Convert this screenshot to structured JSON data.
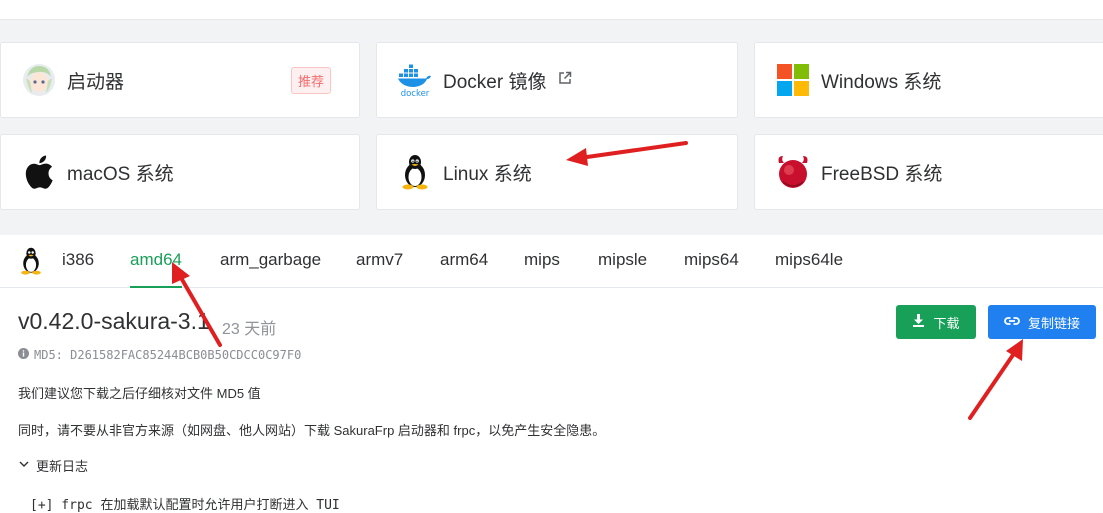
{
  "platforms": [
    {
      "id": "launcher",
      "label": "启动器",
      "badge": "推荐"
    },
    {
      "id": "docker",
      "label": "Docker 镜像",
      "logo_text": "docker"
    },
    {
      "id": "windows",
      "label": "Windows 系统"
    },
    {
      "id": "macos",
      "label": "macOS 系统"
    },
    {
      "id": "linux",
      "label": "Linux 系统"
    },
    {
      "id": "freebsd",
      "label": "FreeBSD 系统"
    }
  ],
  "arch_tabs": [
    "i386",
    "amd64",
    "arm_garbage",
    "armv7",
    "arm64",
    "mips",
    "mipsle",
    "mips64",
    "mips64le"
  ],
  "active_arch": "amd64",
  "release": {
    "version": "v0.42.0-sakura-3.1",
    "time_ago": "23 天前",
    "md5": "MD5: D261582FAC85244BCB0B50CDCC0C97F0",
    "download_label": "下载",
    "copy_link_label": "复制链接",
    "notice_1": "我们建议您下载之后仔细核对文件 MD5 值",
    "notice_2": "同时，请不要从非官方来源（如网盘、他人网站）下载 SakuraFrp 启动器和 frpc，以免产生安全隐患。",
    "changelog_label": "更新日志",
    "changelog_lines": [
      "[+] frpc 在加载默认配置时允许用户打断进入 TUI"
    ]
  },
  "colors": {
    "accent_green": "#18a058",
    "accent_blue": "#2080f0",
    "annotation_red": "#e02020"
  }
}
